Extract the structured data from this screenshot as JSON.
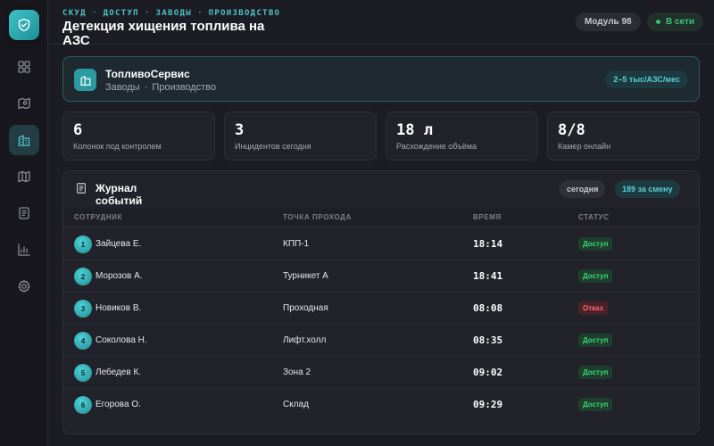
{
  "breadcrumb": [
    "СКУД",
    "ДОСТУП",
    "ЗАВОДЫ",
    "ПРОИЗВОДСТВО"
  ],
  "page_title": "Детекция хищения топлива на АЗС",
  "header": {
    "module_label": "Модуль 98",
    "status_label": "В сети"
  },
  "company": {
    "name": "ТопливоСервис",
    "subtitle_parts": [
      "Заводы",
      "Производство"
    ],
    "price_badge": "2–5 тыс/АЗС/мес"
  },
  "stats": [
    {
      "value": "6",
      "label": "Колонок под контролем"
    },
    {
      "value": "3",
      "label": "Инцидентов сегодня"
    },
    {
      "value": "18 л",
      "label": "Расхождение объёма"
    },
    {
      "value": "8/8",
      "label": "Камер онлайн"
    }
  ],
  "journal": {
    "title": "Журнал событий",
    "filter_label": "сегодня",
    "count_label": "189 за смену",
    "columns": [
      "СОТРУДНИК",
      "ТОЧКА ПРОХОДА",
      "ВРЕМЯ",
      "СТАТУС"
    ],
    "rows": [
      {
        "num": "1",
        "name": "Зайцева Е.",
        "point": "КПП-1",
        "time": "18:14",
        "status": "Доступ",
        "status_kind": "ok"
      },
      {
        "num": "2",
        "name": "Морозов А.",
        "point": "Турникет А",
        "time": "18:41",
        "status": "Доступ",
        "status_kind": "ok"
      },
      {
        "num": "3",
        "name": "Новиков В.",
        "point": "Проходная",
        "time": "08:08",
        "status": "Отказ",
        "status_kind": "deny"
      },
      {
        "num": "4",
        "name": "Соколова Н.",
        "point": "Лифт.холл",
        "time": "08:35",
        "status": "Доступ",
        "status_kind": "ok"
      },
      {
        "num": "5",
        "name": "Лебедев К.",
        "point": "Зона 2",
        "time": "09:02",
        "status": "Доступ",
        "status_kind": "ok"
      },
      {
        "num": "6",
        "name": "Егорова О.",
        "point": "Склад",
        "time": "09:29",
        "status": "Доступ",
        "status_kind": "ok"
      }
    ]
  },
  "sidebar": {
    "icons": [
      "shield-icon",
      "dashboard-icon",
      "map-route-icon",
      "building-icon",
      "map-icon",
      "document-icon",
      "chart-icon",
      "gear-icon"
    ],
    "active": "building-icon"
  },
  "colors": {
    "accent": "#4fc3c8",
    "ok": "#3fd478",
    "deny": "#ff6b76",
    "background": "#1c1c24"
  }
}
